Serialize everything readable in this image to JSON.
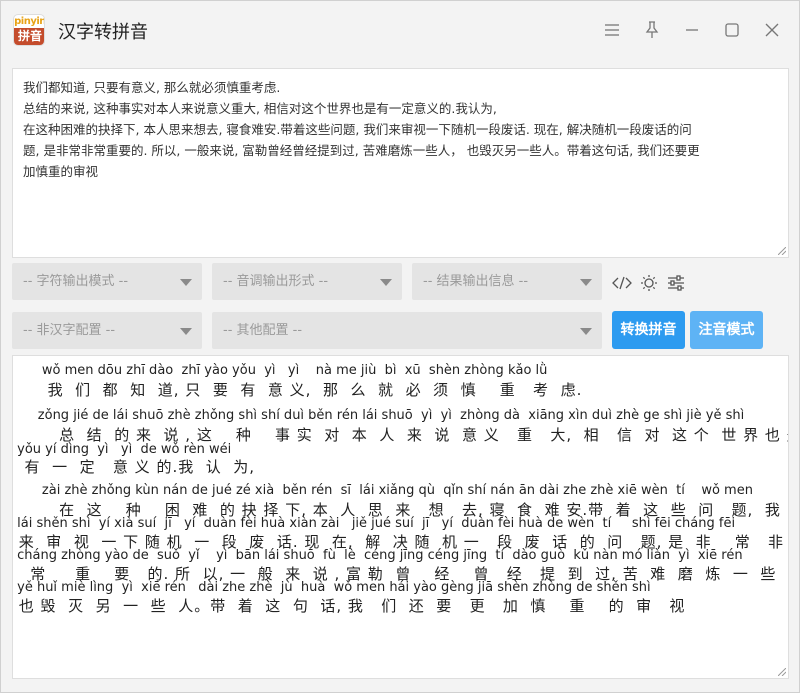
{
  "app": {
    "title": "汉字转拼音",
    "logo_top": "pinyin",
    "logo_bottom": "拼音"
  },
  "window_controls": [
    "menu-icon",
    "pin-icon",
    "minimize-icon",
    "maximize-icon",
    "close-icon"
  ],
  "input": {
    "lines": [
      "我们都知道, 只要有意义, 那么就必须慎重考虑.",
      "总结的来说, 这种事实对本人来说意义重大, 相信对这个世界也是有一定意义的.我认为,",
      "在这种困难的抉择下, 本人思来想去, 寝食难安.带着这些问题, 我们来审视一下随机一段废话. 现在, 解决随机一段废话的问",
      "题, 是非常非常重要的. 所以, 一般来说, 富勒曾经曾经提到过, 苦难磨炼一些人， 也毁灭另一些人。带着这句话, 我们还要更",
      "加慎重的审视"
    ]
  },
  "config": {
    "char_output_mode": "-- 字符输出模式 --",
    "tone_output_form": "-- 音调输出形式 --",
    "result_output_info": "-- 结果输出信息 --",
    "non_hanzi_config": "-- 非汉字配置 --",
    "other_config": "-- 其他配置 --"
  },
  "toolbar_icons": [
    "code-icon",
    "sun-icon",
    "sliders-icon"
  ],
  "buttons": {
    "convert": "转换拼音",
    "annotate_mode": "注音模式"
  },
  "output": {
    "lines": [
      {
        "type": "py",
        "text": "       wǒ men dōu zhī dào  zhī yào yǒu  yì   yì    nà me jiù  bì  xū  shèn zhòng kǎo lǜ"
      },
      {
        "type": "hz",
        "text": "      我  们  都  知  道, 只  要  有  意 义,  那  么  就  必  须  慎    重   考  虑."
      },
      {
        "type": "py",
        "text": "      zǒng jié de lái shuō zhè zhǒng shì shí duì běn rén lái shuō  yì  yì  zhòng dà  xiāng xìn duì zhè ge shì jiè yě shì"
      },
      {
        "type": "hz",
        "text": "        总  结  的 来  说 , 这    种    事 实  对  本  人  来  说  意 义   重   大,  相   信  对  这 个  世 界 也 是"
      },
      {
        "type": "py",
        "text": " yǒu yí dìng  yì   yì  de wǒ rèn wéi"
      },
      {
        "type": "hz",
        "text": "  有  一  定   意 义 的.我  认  为,"
      },
      {
        "type": "py",
        "text": "       zài zhè zhǒng kùn nán de jué zé xià  běn rén  sī  lái xiǎng qù  qǐn shí nán ān dài zhe zhè xiē wèn  tí    wǒ men"
      },
      {
        "type": "hz",
        "text": "        在  这    种    困  难  的 抉 择 下, 本  人  思  来   想   去, 寝  食  难 安.带  着  这  些  问   题,  我   们"
      },
      {
        "type": "py",
        "text": " lái shěn shì  yí xià suí  jī   yí  duàn fèi huà xiàn zài   jiě jué suí  jī   yí  duàn fèi huà de wèn  tí     shì fēi cháng fēi"
      },
      {
        "type": "hz",
        "text": " 来  审  视  一 下 随 机  一  段  废  话. 现  在,  解  决 随  机 一   段  废  话  的  问   题, 是  非    常   非"
      },
      {
        "type": "py",
        "text": " cháng zhòng yào de  suǒ  yǐ    yì  bān lái shuō  fù  lè  céng jīng céng jīng  tí  dào guò  kǔ nàn mó liàn  yì  xiē rén"
      },
      {
        "type": "hz",
        "text": "   常     重    要   的. 所  以, 一  般  来  说 , 富 勒  曾    经    曾   经   提  到  过, 苦  难  磨  炼  一  些  人,"
      },
      {
        "type": "py",
        "text": " yě huǐ miè lìng  yì  xiē rén   dài zhe zhè  jù  huà  wǒ men hái yào gèng jiā shèn zhòng de shěn shì"
      },
      {
        "type": "hz",
        "text": " 也 毁  灭  另  一  些  人。带  着  这  句  话, 我   们  还  要   更   加  慎    重    的  审   视"
      }
    ]
  }
}
